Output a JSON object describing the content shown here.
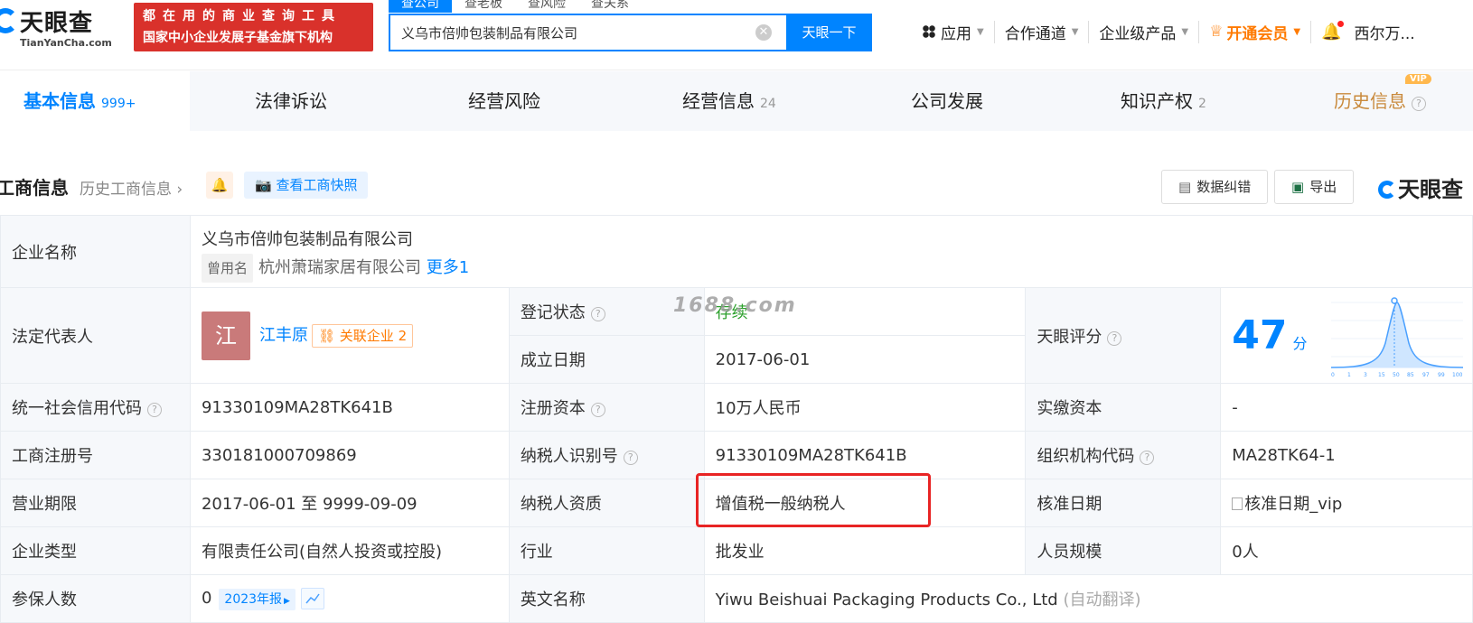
{
  "logo": {
    "cn": "天眼查",
    "en": "TianYanCha.com"
  },
  "banner": {
    "line1": "都在用的商业查询工具",
    "line2": "国家中小企业发展子基金旗下机构"
  },
  "search_tabs": [
    "查公司",
    "查老板",
    "查风险",
    "查关系"
  ],
  "search": {
    "value": "义乌市倍帅包装制品有限公司",
    "button": "天眼一下"
  },
  "topnav": {
    "apps": "应用",
    "partner": "合作通道",
    "enterprise": "企业级产品",
    "vip": "开通会员",
    "user": "西尔万..."
  },
  "tabs": [
    {
      "label": "基本信息",
      "count": "999+"
    },
    {
      "label": "法律诉讼",
      "count": ""
    },
    {
      "label": "经营风险",
      "count": ""
    },
    {
      "label": "经营信息",
      "count": "24"
    },
    {
      "label": "公司发展",
      "count": ""
    },
    {
      "label": "知识产权",
      "count": "2"
    },
    {
      "label": "历史信息",
      "count": ""
    }
  ],
  "vip_badge": "VIP",
  "section": {
    "title": "工商信息",
    "history": "历史工商信息",
    "snapshot": "查看工商快照",
    "correction": "数据纠错",
    "export": "导出",
    "logo": "天眼查"
  },
  "watermark": "1688.com",
  "company": {
    "name_label": "企业名称",
    "name": "义乌市倍帅包装制品有限公司",
    "former_tag": "曾用名",
    "former_name": "杭州萧瑞家居有限公司",
    "more": "更多1",
    "legal_label": "法定代表人",
    "legal_avatar": "江",
    "legal_name": "江丰原",
    "related": "关联企业",
    "related_count": "2",
    "status_label": "登记状态",
    "status": "存续",
    "found_label": "成立日期",
    "found": "2017-06-01",
    "score_label": "天眼评分",
    "score": "47",
    "score_unit": "分",
    "credit_label": "统一社会信用代码",
    "credit": "91330109MA28TK641B",
    "capital_label": "注册资本",
    "capital": "10万人民币",
    "paid_label": "实缴资本",
    "paid": "-",
    "reg_label": "工商注册号",
    "reg": "330181000709869",
    "taxid_label": "纳税人识别号",
    "taxid": "91330109MA28TK641B",
    "org_label": "组织机构代码",
    "org": "MA28TK64-1",
    "term_label": "营业期限",
    "term": "2017-06-01 至 9999-09-09",
    "taxq_label": "纳税人资质",
    "taxq": "增值税一般纳税人",
    "approve_label": "核准日期",
    "approve": "核准日期_vip",
    "type_label": "企业类型",
    "type": "有限责任公司(自然人投资或控股)",
    "industry_label": "行业",
    "industry": "批发业",
    "staff_label": "人员规模",
    "staff": "0人",
    "insured_label": "参保人数",
    "insured": "0",
    "report": "2023年报",
    "en_label": "英文名称",
    "en": "Yiwu Beishuai Packaging Products Co., Ltd",
    "autotrans": "(自动翻译)"
  },
  "score_chart": {
    "ticks": [
      "0",
      "1",
      "3",
      "15",
      "50",
      "85",
      "97",
      "99",
      "100"
    ]
  }
}
